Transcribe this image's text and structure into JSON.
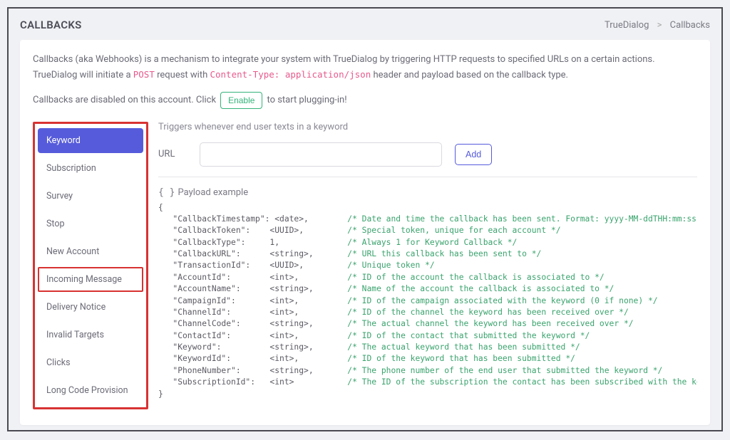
{
  "header": {
    "title": "CALLBACKS",
    "breadcrumb": {
      "root": "TrueDialog",
      "current": "Callbacks",
      "sep": ">"
    }
  },
  "intro": {
    "pre": "Callbacks (aka Webhooks) is a mechanism to integrate your system with TrueDialog by triggering HTTP requests to specified URLs on a certain actions. TrueDialog will initiate a ",
    "code1": "POST",
    "mid": " request with ",
    "code2": "Content-Type: application/json",
    "post": " header and payload based on the callback type."
  },
  "disabled": {
    "pre": "Callbacks are disabled on this account. Click",
    "button": "Enable",
    "post": "to start plugging-in!"
  },
  "sidebar": {
    "items": [
      {
        "label": "Keyword",
        "active": true
      },
      {
        "label": "Subscription"
      },
      {
        "label": "Survey"
      },
      {
        "label": "Stop"
      },
      {
        "label": "New Account"
      },
      {
        "label": "Incoming Message",
        "boxed": true
      },
      {
        "label": "Delivery Notice"
      },
      {
        "label": "Invalid Targets"
      },
      {
        "label": "Clicks"
      },
      {
        "label": "Long Code Provision"
      }
    ]
  },
  "panel": {
    "trigger_desc": "Triggers whenever end user texts in a keyword",
    "url_label": "URL",
    "add_label": "Add",
    "payload_heading": "Payload example"
  },
  "payload": {
    "fields": [
      {
        "key": "CallbackTimestamp",
        "type": "<date>",
        "last": false,
        "comment": "/* Date and time the callback has been sent. Format: yyyy-MM-ddTHH:mm:ss */"
      },
      {
        "key": "CallbackToken",
        "type": "<UUID>",
        "last": false,
        "comment": "/* Special token, unique for each account */"
      },
      {
        "key": "CallbackType",
        "type": "1",
        "last": false,
        "comment": "/* Always 1 for Keyword Callback */"
      },
      {
        "key": "CallbackURL",
        "type": "<string>",
        "last": false,
        "comment": "/* URL this callback has been sent to */"
      },
      {
        "key": "TransactionId",
        "type": "<UUID>",
        "last": false,
        "comment": "/* Unique token */"
      },
      {
        "key": "AccountId",
        "type": "<int>",
        "last": false,
        "comment": "/* ID of the account the callback is associated to */"
      },
      {
        "key": "AccountName",
        "type": "<string>",
        "last": false,
        "comment": "/* Name of the account the callback is associated to */"
      },
      {
        "key": "CampaignId",
        "type": "<int>",
        "last": false,
        "comment": "/* ID of the campaign associated with the keyword (0 if none) */"
      },
      {
        "key": "ChannelId",
        "type": "<int>",
        "last": false,
        "comment": "/* ID of the channel the keyword has been received over */"
      },
      {
        "key": "ChannelCode",
        "type": "<string>",
        "last": false,
        "comment": "/* The actual channel the keyword has been received over */"
      },
      {
        "key": "ContactId",
        "type": "<int>",
        "last": false,
        "comment": "/* ID of the contact that submitted the keyword */"
      },
      {
        "key": "Keyword",
        "type": "<string>",
        "last": false,
        "comment": "/* The actual keyword that has been submitted */"
      },
      {
        "key": "KeywordId",
        "type": "<int>",
        "last": false,
        "comment": "/* ID of the keyword that has been submitted */"
      },
      {
        "key": "PhoneNumber",
        "type": "<string>",
        "last": false,
        "comment": "/* The phone number of the end user that submitted the keyword */"
      },
      {
        "key": "SubscriptionId",
        "type": "<int>",
        "last": true,
        "comment": "/* The ID of the subscription the contact has been subscribed with the keyword */"
      }
    ]
  }
}
